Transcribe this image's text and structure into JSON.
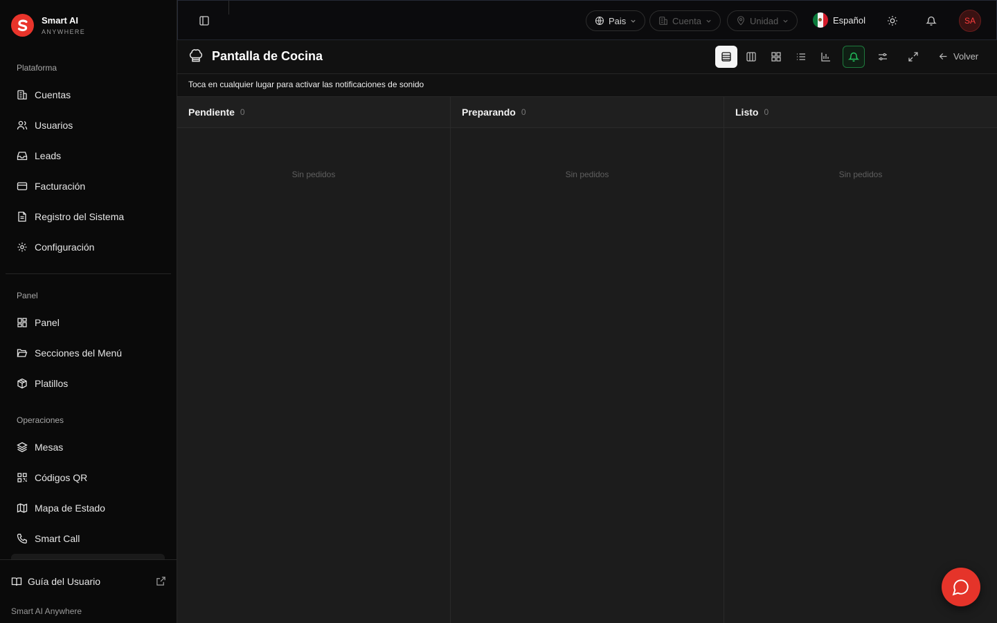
{
  "brand": {
    "name": "Smart AI",
    "subtitle": "ANYWHERE"
  },
  "sidebar": {
    "sections": [
      {
        "label": "Plataforma",
        "items": [
          {
            "label": "Cuentas",
            "icon": "building-icon"
          },
          {
            "label": "Usuarios",
            "icon": "users-icon"
          },
          {
            "label": "Leads",
            "icon": "inbox-icon"
          },
          {
            "label": "Facturación",
            "icon": "credit-card-icon"
          },
          {
            "label": "Registro del Sistema",
            "icon": "file-text-icon"
          },
          {
            "label": "Configuración",
            "icon": "gear-icon"
          }
        ]
      },
      {
        "label": "Panel",
        "items": [
          {
            "label": "Panel",
            "icon": "layout-grid-icon"
          },
          {
            "label": "Secciones del Menú",
            "icon": "folder-open-icon"
          },
          {
            "label": "Platillos",
            "icon": "package-icon"
          }
        ]
      },
      {
        "label": "Operaciones",
        "items": [
          {
            "label": "Mesas",
            "icon": "layers-icon"
          },
          {
            "label": "Códigos QR",
            "icon": "qr-code-icon"
          },
          {
            "label": "Mapa de Estado",
            "icon": "map-icon"
          },
          {
            "label": "Smart Call",
            "icon": "phone-icon"
          }
        ]
      }
    ],
    "footer": {
      "guide_label": "Guía del Usuario",
      "brand_text": "Smart AI Anywhere"
    }
  },
  "topbar": {
    "country": "Pais",
    "account": "Cuenta",
    "unit": "Unidad",
    "language": "Español",
    "avatar_initials": "SA"
  },
  "page": {
    "title": "Pantalla de Cocina",
    "back_label": "Volver",
    "notice": "Toca en cualquier lugar para activar las notificaciones de sonido"
  },
  "board": {
    "columns": [
      {
        "title": "Pendiente",
        "count": "0",
        "empty": "Sin pedidos"
      },
      {
        "title": "Preparando",
        "count": "0",
        "empty": "Sin pedidos"
      },
      {
        "title": "Listo",
        "count": "0",
        "empty": "Sin pedidos"
      }
    ]
  },
  "colors": {
    "accent": "#e5342a",
    "bell_active": "#22c55e"
  }
}
